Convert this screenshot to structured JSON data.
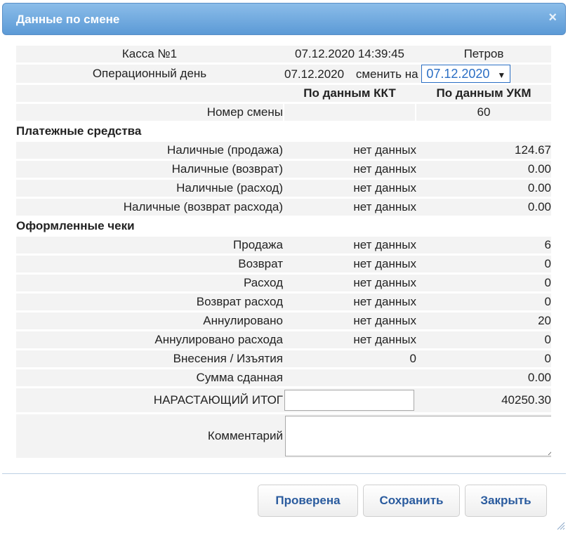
{
  "dialog": {
    "title": "Данные по смене",
    "close_symbol": "×"
  },
  "info": {
    "kassa_label": "Касса №1",
    "datetime": "07.12.2020 14:39:45",
    "operator": "Петров",
    "opday_label": "Операционный день",
    "opday_date": "07.12.2020",
    "change_label": "сменить на",
    "change_value": "07.12.2020"
  },
  "columns": {
    "kkt": "По данным ККТ",
    "ukm": "По данным УКМ"
  },
  "shift": {
    "label": "Номер смены",
    "kkt": "",
    "ukm": "60"
  },
  "payment": {
    "title": "Платежные средства",
    "rows": [
      {
        "label": "Наличные (продажа)",
        "kkt": "нет данных",
        "ukm": "124.67"
      },
      {
        "label": "Наличные (возврат)",
        "kkt": "нет данных",
        "ukm": "0.00"
      },
      {
        "label": "Наличные (расход)",
        "kkt": "нет данных",
        "ukm": "0.00"
      },
      {
        "label": "Наличные (возврат расхода)",
        "kkt": "нет данных",
        "ukm": "0.00"
      }
    ]
  },
  "checks": {
    "title": "Оформленные чеки",
    "rows": [
      {
        "label": "Продажа",
        "kkt": "нет данных",
        "ukm": "6"
      },
      {
        "label": "Возврат",
        "kkt": "нет данных",
        "ukm": "0"
      },
      {
        "label": "Расход",
        "kkt": "нет данных",
        "ukm": "0"
      },
      {
        "label": "Возврат расход",
        "kkt": "нет данных",
        "ukm": "0"
      },
      {
        "label": "Аннулировано",
        "kkt": "нет данных",
        "ukm": "20"
      },
      {
        "label": "Аннулировано расхода",
        "kkt": "нет данных",
        "ukm": "0"
      },
      {
        "label": "Внесения / Изъятия",
        "kkt": "0",
        "ukm": "0"
      },
      {
        "label": "Сумма сданная",
        "kkt": "",
        "ukm": "0.00"
      }
    ]
  },
  "total": {
    "label": "НАРАСТАЮЩИЙ ИТОГ",
    "input_value": "",
    "ukm": "40250.30"
  },
  "comment": {
    "label": "Комментарий",
    "value": ""
  },
  "buttons": {
    "checked": "Проверена",
    "save": "Сохранить",
    "close": "Закрыть"
  }
}
